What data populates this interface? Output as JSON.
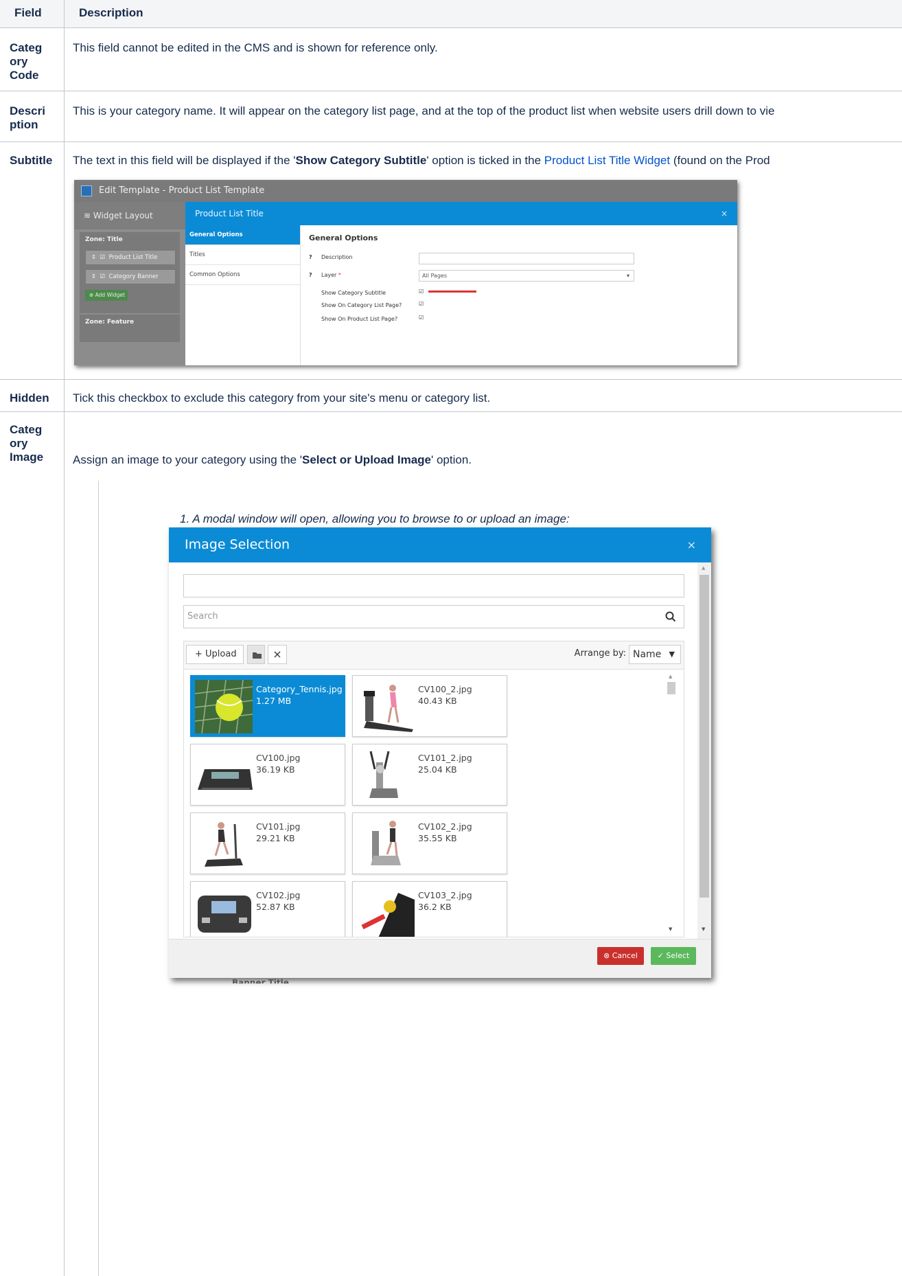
{
  "table": {
    "header": {
      "field": "Field",
      "description": "Description"
    },
    "rows": [
      {
        "field": "Categ ory Code",
        "description": "This field cannot be edited in the CMS and is shown for reference only."
      },
      {
        "field": "Descri ption",
        "description": "This is your category name. It will appear on the category list page, and at the top of the product list when website users drill down to vie"
      },
      {
        "field": "Subtitle",
        "description_prefix": "The text in this field will be displayed if the '",
        "description_bold": "Show Category Subtitle",
        "description_mid": "' option is ticked in the ",
        "description_link": "Product List Title Widget",
        "description_suffix": " (found on the Prod"
      },
      {
        "field": "Hidden",
        "description": "Tick this checkbox to exclude this category from your site's menu or category list."
      },
      {
        "field": "Categ ory Image",
        "description_prefix": "Assign an image to your category using the '",
        "description_bold": "Select or Upload Image",
        "description_suffix": "' option."
      }
    ]
  },
  "step1": "1.  A modal window will open, allowing you to browse to or upload an image:",
  "shot_edit_template": {
    "window_title": "Edit Template - Product List Template",
    "widget_layout": "Widget Layout",
    "zone_title": "Zone: Title",
    "widgets": [
      "Product List Title",
      "Category Banner"
    ],
    "add_widget": "Add Widget",
    "zone_feature": "Zone: Feature",
    "dialog_title": "Product List Title",
    "nav": [
      "General Options",
      "Titles",
      "Common Options"
    ],
    "section_heading": "General Options",
    "fields": {
      "description_label": "Description",
      "layer_label": "Layer",
      "layer_value": "All Pages",
      "show_subtitle": "Show Category Subtitle",
      "show_on_cat_list": "Show On Category List Page?",
      "show_on_prod_list": "Show On Product List Page?"
    }
  },
  "image_selection": {
    "title": "Image Selection",
    "search_placeholder": "Search",
    "upload_label": "+ Upload",
    "arrange_by_label": "Arrange by:",
    "arrange_value": "Name",
    "tiles": [
      {
        "name": "Category_Tennis.jpg",
        "size": "1.27 MB",
        "selected": true
      },
      {
        "name": "CV100_2.jpg",
        "size": "40.43 KB"
      },
      {
        "name": "CV100.jpg",
        "size": "36.19 KB"
      },
      {
        "name": "CV101_2.jpg",
        "size": "25.04 KB"
      },
      {
        "name": "CV101.jpg",
        "size": "29.21 KB"
      },
      {
        "name": "CV102_2.jpg",
        "size": "35.55 KB"
      },
      {
        "name": "CV102.jpg",
        "size": "52.87 KB"
      },
      {
        "name": "CV103_2.jpg",
        "size": "36.2 KB"
      }
    ],
    "cancel_label": "Cancel",
    "select_label": "Select",
    "behind_text": "Banner Title"
  },
  "colors": {
    "accent": "#0b8bd6",
    "cancel": "#c9302c",
    "select": "#5cb85c",
    "link": "#0052cc"
  }
}
